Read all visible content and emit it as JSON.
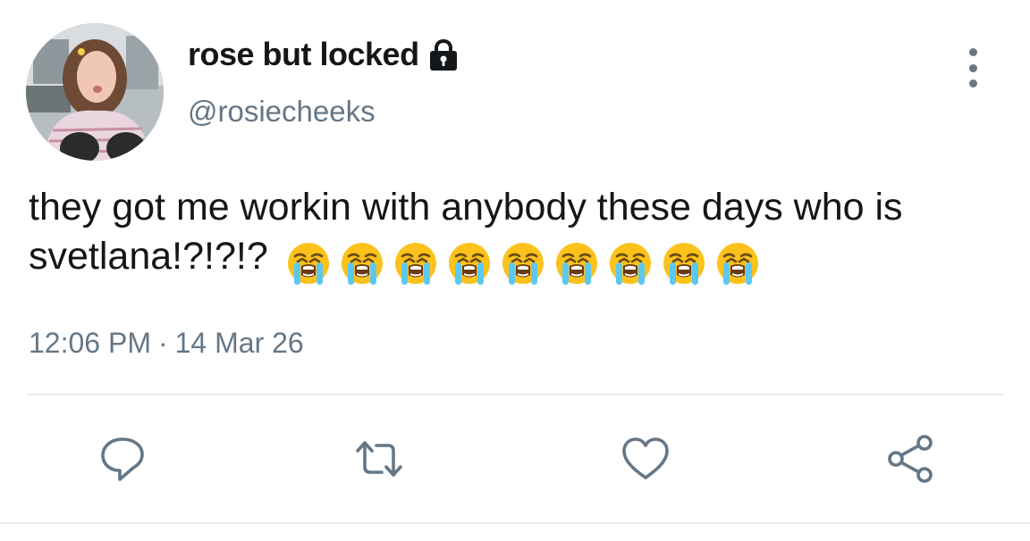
{
  "author": {
    "display_name": "rose but locked",
    "handle": "@rosiecheeks",
    "protected_icon": "lock-icon",
    "avatar_icon": "profile-photo"
  },
  "tweet": {
    "text": "they got me workin with anybody these days who is svetlana!?!?!?",
    "emoji": [
      "😭",
      "😭",
      "😭",
      "😭",
      "😭",
      "😭",
      "😭",
      "😭",
      "😭"
    ],
    "time": "12:06 PM",
    "separator": "·",
    "date": "14 Mar 26"
  },
  "actions": [
    {
      "name": "reply",
      "icon": "reply-icon"
    },
    {
      "name": "retweet",
      "icon": "retweet-icon"
    },
    {
      "name": "like",
      "icon": "heart-icon"
    },
    {
      "name": "share",
      "icon": "share-icon"
    }
  ],
  "menu_icon": "more-vertical-icon",
  "colors": {
    "text": "#14171a",
    "secondary": "#657786",
    "divider": "#e6ecf0"
  }
}
